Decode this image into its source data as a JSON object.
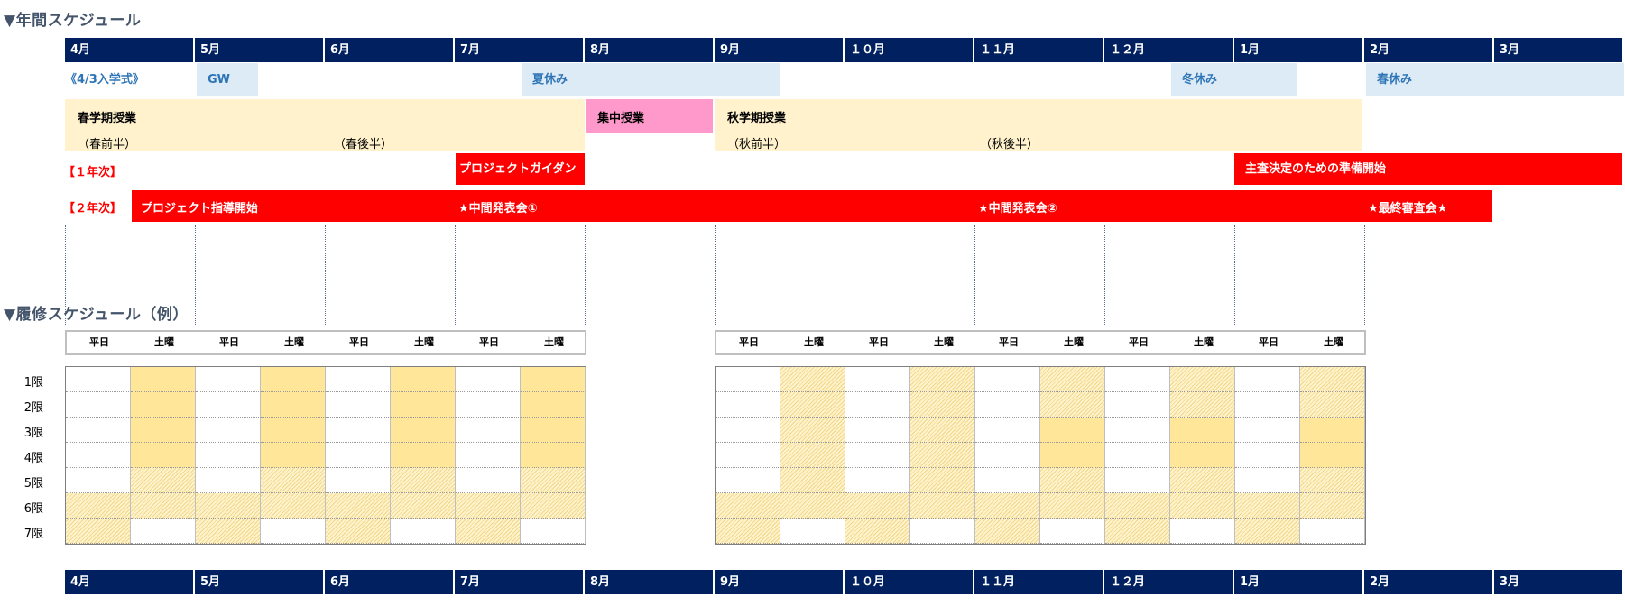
{
  "sections": {
    "annual": "▼年間スケジュール",
    "enrollment": "▼履修スケジュール（例）"
  },
  "months": [
    "4月",
    "5月",
    "6月",
    "7月",
    "8月",
    "9月",
    "１０月",
    "１１月",
    "１２月",
    "1月",
    "2月",
    "3月"
  ],
  "periods": {
    "entrance": "《4/3入学式》",
    "gw": "GW",
    "summer": "夏休み",
    "winter": "冬休み",
    "spring": "春休み"
  },
  "terms": {
    "spring": {
      "label": "春学期授業",
      "first_half": "（春前半）",
      "second_half": "（春後半）"
    },
    "intensive": {
      "label": "集中授業"
    },
    "autumn": {
      "label": "秋学期授業",
      "first_half": "（秋前半）",
      "second_half": "（秋後半）"
    }
  },
  "year1": {
    "label": "【１年次】",
    "guidance": "プロジェクトガイダンス",
    "advisor": "主査決定のための準備開始"
  },
  "year2": {
    "label": "【２年次】",
    "start": "プロジェクト指導開始",
    "mid1": "★中間発表会①",
    "mid2": "★中間発表会②",
    "final": "★最終審査会★"
  },
  "day_types": [
    "平日",
    "土曜"
  ],
  "class_periods": [
    "1限",
    "2限",
    "3限",
    "4限",
    "5限",
    "6限",
    "7限"
  ],
  "colors": {
    "month_header": "#002060",
    "break_fill": "#ddebf7",
    "break_text": "#2e75b6",
    "term_fill": "#fff2cc",
    "intensive_fill": "#ff99cc",
    "project_bar": "#ff0000",
    "class_solid": "#ffe699"
  },
  "grid_pattern": {
    "legend": [
      "w = 授業なし",
      "s = 授業",
      "h = 授業（選択）"
    ],
    "spring_columns": [
      [
        "w",
        "w",
        "w",
        "w",
        "w",
        "h",
        "h"
      ],
      [
        "s",
        "s",
        "s",
        "s",
        "h",
        "h",
        "w"
      ]
    ],
    "autumn_columns_a": [
      [
        "w",
        "w",
        "w",
        "w",
        "w",
        "h",
        "h"
      ],
      [
        "h",
        "h",
        "h",
        "h",
        "h",
        "h",
        "w"
      ]
    ],
    "autumn_columns_b": [
      [
        "w",
        "w",
        "w",
        "w",
        "w",
        "h",
        "h"
      ],
      [
        "h",
        "h",
        "s",
        "s",
        "h",
        "h",
        "w"
      ]
    ]
  }
}
